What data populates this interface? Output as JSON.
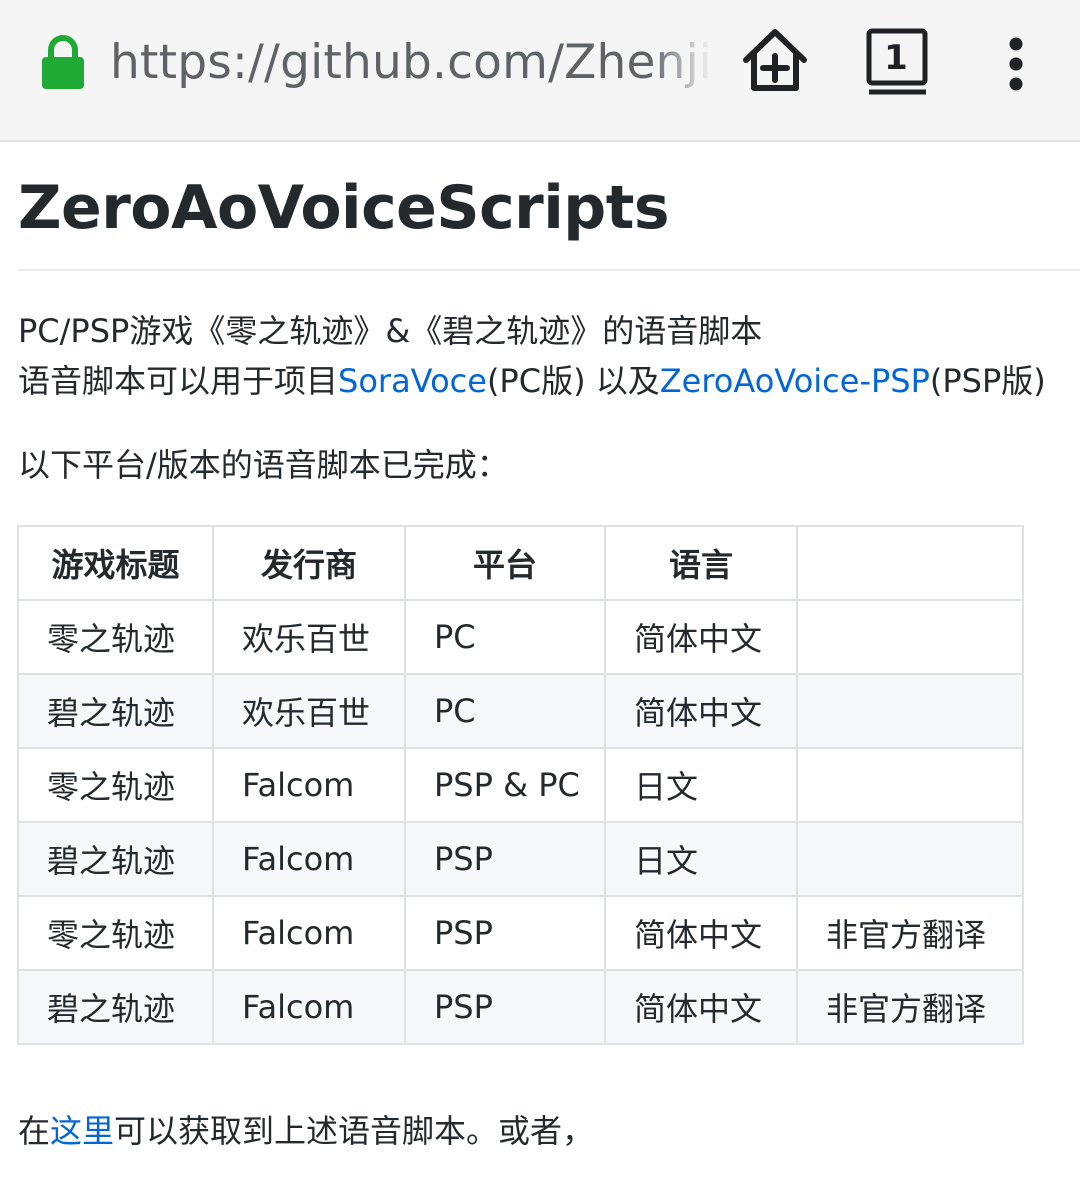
{
  "browser": {
    "url": "https://github.com/Zhenjia",
    "tab_count": "1",
    "icons": {
      "lock": "lock-icon",
      "home": "add-to-home-icon",
      "tabs": "tab-switcher-icon",
      "menu": "overflow-menu-icon"
    },
    "lock_color": "#1faa36"
  },
  "repo": {
    "title": "ZeroAoVoiceScripts"
  },
  "description": {
    "line1": "PC/PSP游戏《零之轨迹》&《碧之轨迹》的语音脚本",
    "line2_prefix": "语音脚本可以用于项目",
    "link1": "SoraVoce",
    "line2_middle": "(PC版) 以及",
    "link2": "ZeroAoVoice-PSP",
    "line2_suffix": "(PSP版)",
    "line3": "以下平台/版本的语音脚本已完成："
  },
  "table": {
    "headers": [
      "游戏标题",
      "发行商",
      "平台",
      "语言",
      ""
    ],
    "rows": [
      [
        "零之轨迹",
        "欢乐百世",
        "PC",
        "简体中文",
        ""
      ],
      [
        "碧之轨迹",
        "欢乐百世",
        "PC",
        "简体中文",
        ""
      ],
      [
        "零之轨迹",
        "Falcom",
        "PSP & PC",
        "日文",
        ""
      ],
      [
        "碧之轨迹",
        "Falcom",
        "PSP",
        "日文",
        ""
      ],
      [
        "零之轨迹",
        "Falcom",
        "PSP",
        "简体中文",
        "非官方翻译"
      ],
      [
        "碧之轨迹",
        "Falcom",
        "PSP",
        "简体中文",
        "非官方翻译"
      ]
    ]
  },
  "footer": {
    "prefix": "在",
    "link": "这里",
    "suffix": "可以获取到上述语音脚本。或者，"
  },
  "colors": {
    "link": "#0366d6",
    "text": "#24292e",
    "border": "#dfe2e5",
    "alt_row": "#f6f8fa"
  }
}
